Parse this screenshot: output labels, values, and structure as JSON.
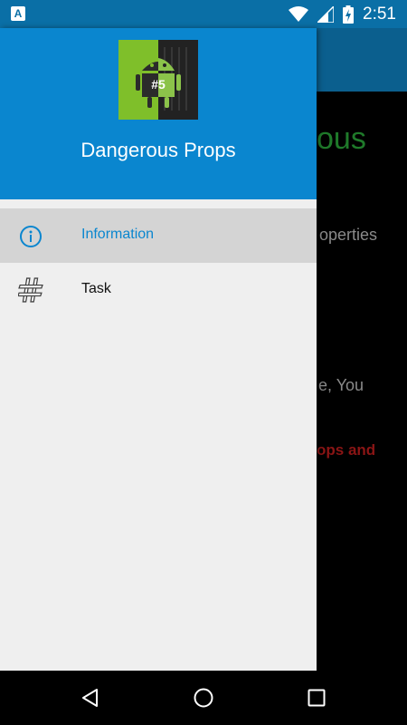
{
  "status_bar": {
    "time": "2:51",
    "left_icon": "A"
  },
  "background": {
    "title_fragment": "ous",
    "line1_fragment": "operties",
    "line2_fragment": "e, You",
    "line3_fragment": "ops and"
  },
  "drawer": {
    "title": "Dangerous Props",
    "logo_badge": "#5",
    "items": [
      {
        "label": "Information",
        "icon": "info-icon",
        "active": true
      },
      {
        "label": "Task",
        "icon": "hash-icon",
        "active": false
      }
    ]
  },
  "navbar": {
    "buttons": [
      "back-icon",
      "home-icon",
      "recents-icon"
    ]
  },
  "colors": {
    "header": "#0a86cf",
    "status_bar": "#0a6fa6",
    "active_item_bg": "#d4d4d4",
    "accent": "#0a86cf"
  }
}
